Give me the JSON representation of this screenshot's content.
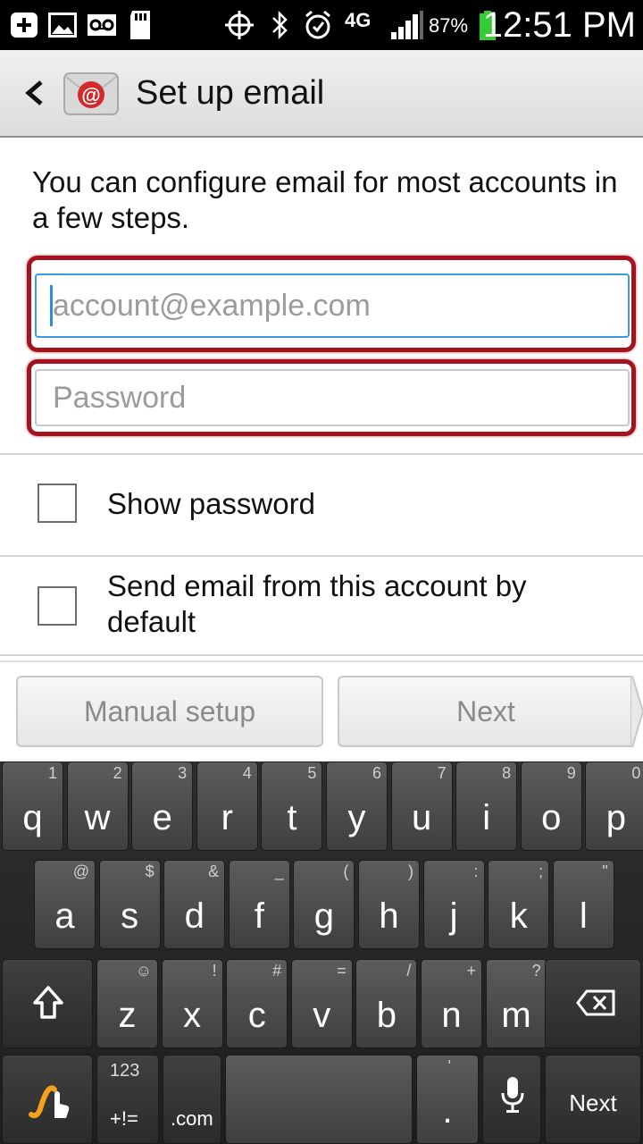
{
  "status_bar": {
    "time": "12:51 PM",
    "battery_percent": "87%",
    "network": "4G",
    "icons": [
      "add-icon",
      "image-icon",
      "voicemail-icon",
      "sd-card-icon",
      "gps-icon",
      "bluetooth-icon",
      "alarm-icon",
      "network-4g-icon",
      "signal-icon",
      "battery-icon"
    ]
  },
  "action_bar": {
    "title": "Set up email",
    "back_icon": "chevron-left-icon",
    "app_icon": "email-at-icon"
  },
  "intro_text": "You can configure email for most accounts in a few steps.",
  "email_field": {
    "placeholder": "account@example.com",
    "value": ""
  },
  "password_field": {
    "placeholder": "Password",
    "value": ""
  },
  "checkboxes": {
    "show_password": {
      "label": "Show password",
      "checked": false
    },
    "send_default": {
      "label": "Send email from this account by default",
      "checked": false
    }
  },
  "buttons": {
    "manual_setup": "Manual setup",
    "next": "Next"
  },
  "keyboard": {
    "row1": [
      {
        "k": "q",
        "s": "1"
      },
      {
        "k": "w",
        "s": "2"
      },
      {
        "k": "e",
        "s": "3"
      },
      {
        "k": "r",
        "s": "4"
      },
      {
        "k": "t",
        "s": "5"
      },
      {
        "k": "y",
        "s": "6"
      },
      {
        "k": "u",
        "s": "7"
      },
      {
        "k": "i",
        "s": "8"
      },
      {
        "k": "o",
        "s": "9"
      },
      {
        "k": "p",
        "s": "0"
      }
    ],
    "row2": [
      {
        "k": "a",
        "s": "@"
      },
      {
        "k": "s",
        "s": "$"
      },
      {
        "k": "d",
        "s": "&"
      },
      {
        "k": "f",
        "s": "_"
      },
      {
        "k": "g",
        "s": "("
      },
      {
        "k": "h",
        "s": ")"
      },
      {
        "k": "j",
        "s": ":"
      },
      {
        "k": "k",
        "s": ";"
      },
      {
        "k": "l",
        "s": "\""
      }
    ],
    "row3": [
      {
        "k": "z",
        "s": "☺"
      },
      {
        "k": "x",
        "s": "!"
      },
      {
        "k": "c",
        "s": "#"
      },
      {
        "k": "v",
        "s": "="
      },
      {
        "k": "b",
        "s": "/"
      },
      {
        "k": "n",
        "s": "+"
      },
      {
        "k": "m",
        "s": "?"
      }
    ],
    "symbols_key": {
      "top": "123",
      "bottom": "+!="
    },
    "dotcom_key": ".com",
    "period_key": {
      "main": ".",
      "sub": "'"
    },
    "next_key": "Next"
  },
  "colors": {
    "highlight": "#a5141e",
    "focus": "#3b9ae0",
    "keyboard": "#2a2a2a"
  }
}
